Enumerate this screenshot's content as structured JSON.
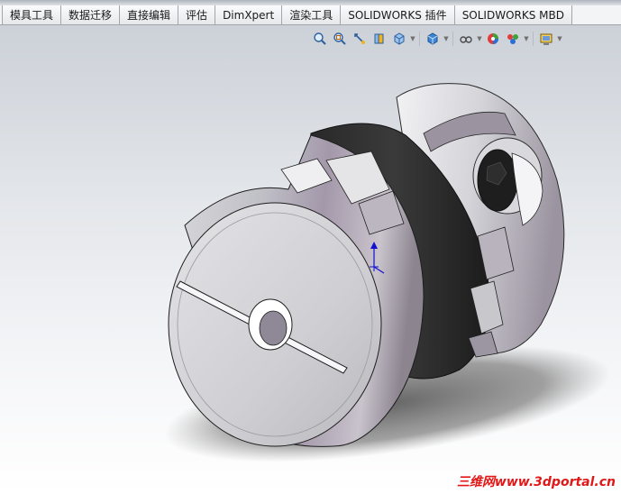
{
  "tabs": [
    "模具工具",
    "数据迁移",
    "直接编辑",
    "评估",
    "DimXpert",
    "渲染工具",
    "SOLIDWORKS 插件",
    "SOLIDWORKS MBD"
  ],
  "view_toolbar": {
    "icons": [
      {
        "name": "zoom-to-fit-icon"
      },
      {
        "name": "zoom-to-area-icon"
      },
      {
        "name": "previous-view-icon"
      },
      {
        "name": "section-view-icon"
      },
      {
        "name": "view-orientation-icon",
        "dropdown": true
      },
      {
        "name": "display-style-icon",
        "dropdown": true
      },
      {
        "name": "hide-show-items-icon",
        "dropdown": true
      },
      {
        "name": "edit-appearance-icon"
      },
      {
        "name": "apply-scene-icon",
        "dropdown": true
      },
      {
        "name": "view-settings-icon",
        "dropdown": true
      }
    ]
  },
  "model": {
    "name": "oldham-coupling"
  },
  "watermark": "三维网www.3dportal.cn"
}
